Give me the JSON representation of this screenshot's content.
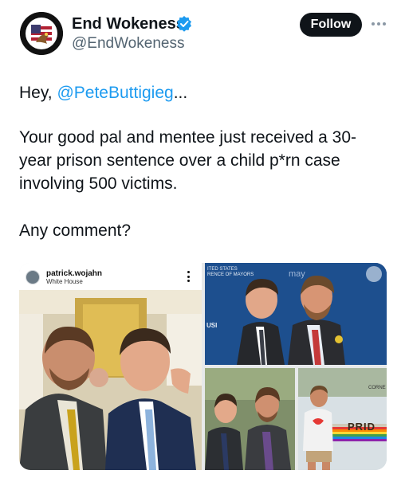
{
  "author": {
    "display_name": "End Wokeness",
    "handle": "@EndWokeness",
    "verified": true,
    "avatar_label_top": "SUPPORT THE",
    "avatar_label_bottom": "FORMER THEMES",
    "avatar_icon": "eagle-emblem-icon"
  },
  "actions": {
    "follow_label": "Follow",
    "more_icon": "more-horizontal-icon"
  },
  "tweet": {
    "greeting": "Hey, ",
    "mention": "@PeteButtigieg",
    "greeting_suffix": "...",
    "body": "Your good pal and mentee just received a 30-year prison sentence over a child p*rn case involving 500 victims.",
    "question": "Any comment?"
  },
  "media": {
    "instagram": {
      "username": "patrick.wojahn",
      "location": "White House",
      "menu_icon": "more-vertical-icon"
    },
    "photo_top_right": {
      "banner_text": "ITED STATES\nRENCE OF MAYORS",
      "may_text": "may",
      "usf_text": "USI"
    },
    "photo_bottom_right": {
      "corner_text": "CORNE",
      "sign_text": "PRID"
    }
  },
  "colors": {
    "accent": "#1d9bf0",
    "text": "#0f1419",
    "secondary": "#536471",
    "follow_bg": "#0f1419"
  }
}
